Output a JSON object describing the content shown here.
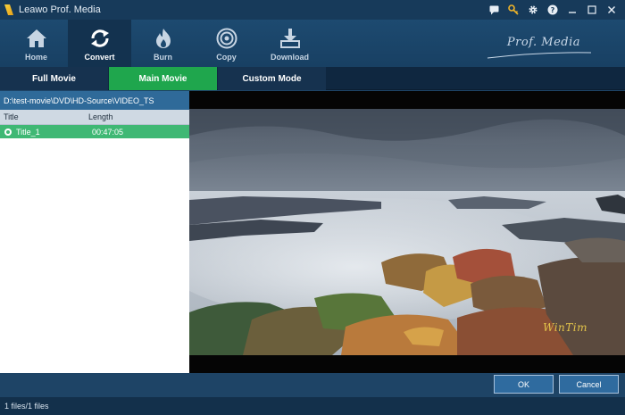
{
  "window": {
    "title": "Leawo Prof. Media",
    "controls": [
      "chat-icon",
      "key-icon",
      "gear-icon",
      "help-icon",
      "minimize-icon",
      "maximize-icon",
      "close-icon"
    ]
  },
  "toolbar": {
    "items": [
      {
        "label": "Home",
        "icon": "home-icon",
        "active": false
      },
      {
        "label": "Convert",
        "icon": "convert-icon",
        "active": true
      },
      {
        "label": "Burn",
        "icon": "burn-icon",
        "active": false
      },
      {
        "label": "Copy",
        "icon": "copy-icon",
        "active": false
      },
      {
        "label": "Download",
        "icon": "download-icon",
        "active": false
      }
    ],
    "brand": "Prof. Media"
  },
  "mode_tabs": [
    {
      "label": "Full Movie",
      "active": false
    },
    {
      "label": "Main Movie",
      "active": true
    },
    {
      "label": "Custom Mode",
      "active": false
    }
  ],
  "file_panel": {
    "path": "D:\\test-movie\\DVD\\HD-Source\\VIDEO_TS",
    "columns": [
      "Title",
      "Length"
    ],
    "rows": [
      {
        "title": "Title_1",
        "length": "00:47:05",
        "selected": true
      }
    ]
  },
  "preview": {
    "watermark": "WinTim"
  },
  "buttons": {
    "ok": "OK",
    "cancel": "Cancel"
  },
  "status": {
    "text": "1 files/1 files"
  },
  "colors": {
    "accent_green": "#1fa64d",
    "row_selected": "#3fb874",
    "toolbar_bg": "#1d4a70"
  }
}
